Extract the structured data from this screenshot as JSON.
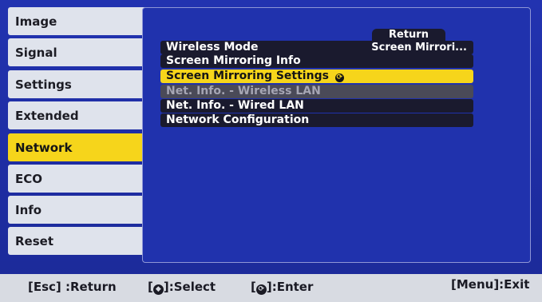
{
  "sidebar": {
    "items": [
      {
        "label": "Image"
      },
      {
        "label": "Signal"
      },
      {
        "label": "Settings"
      },
      {
        "label": "Extended"
      },
      {
        "label": "Network",
        "active": true
      },
      {
        "label": "ECO"
      },
      {
        "label": "Info"
      },
      {
        "label": "Reset"
      }
    ]
  },
  "panel": {
    "return_label": "Return",
    "rows": [
      {
        "label": "Wireless Mode",
        "value": "Screen Mirrori..."
      },
      {
        "label": "Screen Mirroring Info"
      },
      {
        "label": "Screen Mirroring Settings",
        "state": "selected",
        "icon": "enter-icon"
      },
      {
        "label": "Net. Info. - Wireless LAN",
        "state": "disabled"
      },
      {
        "label": "Net. Info. - Wired LAN"
      },
      {
        "label": "Network Configuration"
      }
    ]
  },
  "footer": {
    "esc": "[Esc] :Return",
    "select_prefix": "[",
    "select_suffix": "]:Select",
    "enter_prefix": "[",
    "enter_suffix": "]:Enter",
    "menu": "[Menu]:Exit"
  },
  "colors": {
    "background": "#1f2fa6",
    "highlight": "#f6d51b",
    "menu_item": "#dfe3ec",
    "row_bg": "#1a1a2e"
  }
}
